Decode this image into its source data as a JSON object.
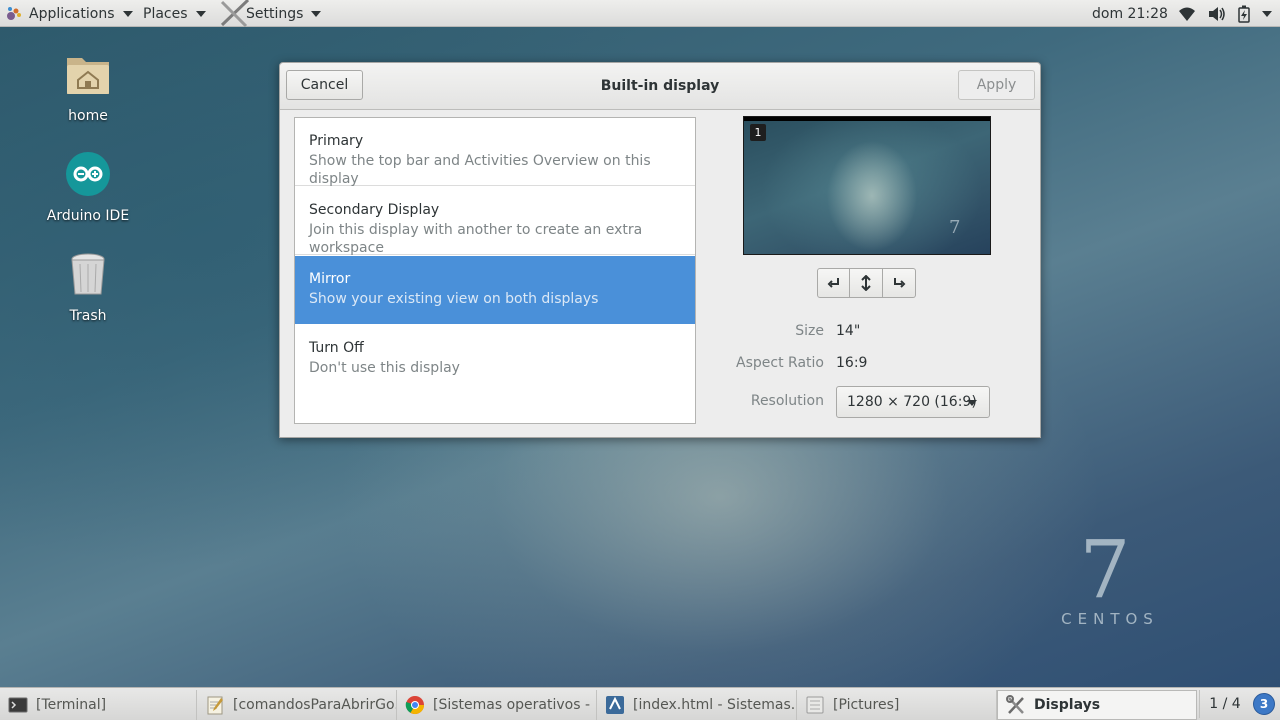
{
  "top_panel": {
    "applications_label": "Applications",
    "places_label": "Places",
    "settings_label": "Settings",
    "clock": "dom 21:28"
  },
  "desktop_icons": [
    {
      "label": "home",
      "icon": "home-folder-icon"
    },
    {
      "label": "Arduino IDE",
      "icon": "arduino-icon"
    },
    {
      "label": "Trash",
      "icon": "trash-icon"
    }
  ],
  "dialog": {
    "title": "Built-in display",
    "cancel_label": "Cancel",
    "apply_label": "Apply",
    "modes": [
      {
        "title": "Primary",
        "description": "Show the top bar and Activities Overview on this display",
        "selected": false
      },
      {
        "title": "Secondary Display",
        "description": "Join this display with another to create an extra workspace",
        "selected": false
      },
      {
        "title": "Mirror",
        "description": "Show your existing view on both displays",
        "selected": true
      },
      {
        "title": "Turn Off",
        "description": "Don't use this display",
        "selected": false
      }
    ],
    "preview_badge": "1",
    "preview_logo": "7",
    "size_label": "Size",
    "size_value": "14\"",
    "aspect_label": "Aspect Ratio",
    "aspect_value": "16:9",
    "resolution_label": "Resolution",
    "resolution_value": "1280 × 720 (16:9)"
  },
  "wallpaper_logo": {
    "number": "7",
    "word": "CENTOS"
  },
  "taskbar": {
    "tasks": [
      {
        "label": "[Terminal]",
        "icon": "terminal-icon",
        "active": false
      },
      {
        "label": "[comandosParaAbrirGo...",
        "icon": "text-editor-icon",
        "active": false
      },
      {
        "label": "[Sistemas operativos - ...",
        "icon": "chrome-icon",
        "active": false
      },
      {
        "label": "[index.html - Sistemas...",
        "icon": "code-editor-icon",
        "active": false
      },
      {
        "label": "[Pictures]",
        "icon": "file-manager-icon",
        "active": false
      },
      {
        "label": "Displays",
        "icon": "settings-tools-icon",
        "active": true
      }
    ],
    "workspace": "1 / 4",
    "notifications": "3"
  },
  "colors": {
    "selection": "#4a90d9",
    "notification": "#3c78c6"
  }
}
